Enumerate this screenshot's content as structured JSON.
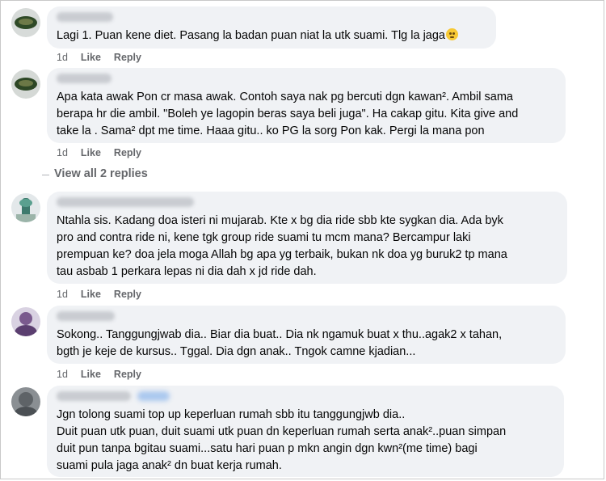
{
  "comments": [
    {
      "text": "Lagi 1. Puan kene diet. Pasang la badan puan niat la utk suami. Tlg la jaga",
      "emoji": "pleading-face",
      "time": "1d",
      "like_label": "Like",
      "reply_label": "Reply"
    },
    {
      "text": "Apa kata awak Pon cr masa awak. Contoh saya nak pg bercuti dgn kawan². Ambil sama\nberapa hr die ambil. \"Boleh ye lagopin beras saya beli juga\". Ha cakap gitu. Kita give and\ntake la . Sama² dpt me time. Haaa gitu.. ko PG la sorg Pon kak. Pergi la mana pon",
      "time": "1d",
      "like_label": "Like",
      "reply_label": "Reply",
      "view_replies": "View all 2 replies"
    },
    {
      "text": "Ntahla sis. Kadang doa isteri ni mujarab. Kte x bg dia ride sbb kte sygkan dia. Ada byk\npro and contra ride ni, kene tgk group ride suami tu mcm mana? Bercampur laki\nprempuan ke? doa jela moga Allah bg apa yg terbaik, bukan nk doa yg buruk2 tp mana\ntau asbab 1 perkara lepas ni dia dah x jd ride dah.",
      "time": "1d",
      "like_label": "Like",
      "reply_label": "Reply"
    },
    {
      "text": "Sokong.. Tanggungjwab dia.. Biar dia buat.. Dia nk ngamuk buat x thu..agak2 x tahan,\nbgth je keje de kursus.. Tggal. Dia dgn anak.. Tngok camne kjadian...",
      "time": "1d",
      "like_label": "Like",
      "reply_label": "Reply"
    },
    {
      "text": "Jgn tolong suami top up keperluan rumah sbb itu tanggungjwb dia..\nDuit puan utk puan, duit suami utk puan dn keperluan rumah serta anak²..puan simpan\nduit pun tanpa bgitau suami...satu hari puan p mkn angin dgn kwn²(me time) bagi\nsuami pula jaga anak² dn buat kerja rumah."
    }
  ],
  "colors": {
    "bubble": "#f0f2f5",
    "meta_text": "#65676b",
    "body_text": "#050505"
  }
}
